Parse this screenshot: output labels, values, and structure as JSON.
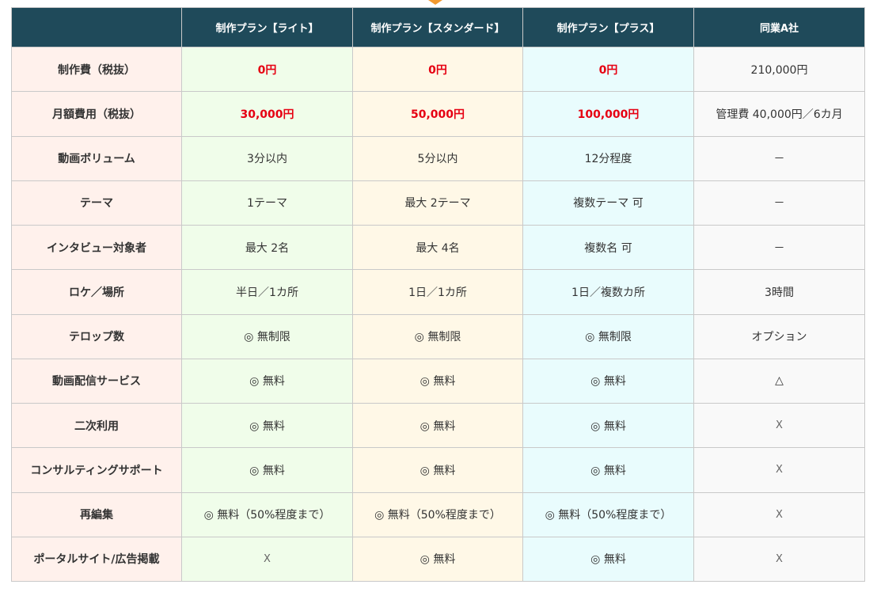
{
  "header": [
    "",
    "制作プラン【ライト】",
    "制作プラン【スタンダード】",
    "制作プラン【プラス】",
    "同業A社"
  ],
  "rows": [
    {
      "label": "制作費（税抜）",
      "cells": [
        "0円",
        "0円",
        "0円",
        "210,000円"
      ],
      "highlight": true
    },
    {
      "label": "月額費用（税抜）",
      "cells": [
        "30,000円",
        "50,000円",
        "100,000円",
        "管理費 40,000円／6カ月"
      ],
      "highlight": true
    },
    {
      "label": "動画ボリューム",
      "cells": [
        "3分以内",
        "5分以内",
        "12分程度",
        "－"
      ]
    },
    {
      "label": "テーマ",
      "cells": [
        "1テーマ",
        "最大 2テーマ",
        "複数テーマ 可",
        "－"
      ]
    },
    {
      "label": "インタビュー対象者",
      "cells": [
        "最大 2名",
        "最大 4名",
        "複数名 可",
        "－"
      ]
    },
    {
      "label": "ロケ／場所",
      "cells": [
        "半日／1カ所",
        "1日／1カ所",
        "1日／複数カ所",
        "3時間"
      ]
    },
    {
      "label": "テロップ数",
      "cells": [
        "◎ 無制限",
        "◎ 無制限",
        "◎ 無制限",
        "オプション"
      ]
    },
    {
      "label": "動画配信サービス",
      "cells": [
        "◎ 無料",
        "◎ 無料",
        "◎ 無料",
        "△"
      ]
    },
    {
      "label": "二次利用",
      "cells": [
        "◎ 無料",
        "◎ 無料",
        "◎ 無料",
        "X"
      ]
    },
    {
      "label": "コンサルティングサポート",
      "cells": [
        "◎ 無料",
        "◎ 無料",
        "◎ 無料",
        "X"
      ]
    },
    {
      "label": "再編集",
      "cells": [
        "◎ 無料（50%程度まで）",
        "◎ 無料（50%程度まで）",
        "◎ 無料（50%程度まで）",
        "X"
      ]
    },
    {
      "label": "ポータルサイト/広告掲載",
      "cells": [
        "X",
        "◎ 無料",
        "◎ 無料",
        "X"
      ]
    }
  ]
}
